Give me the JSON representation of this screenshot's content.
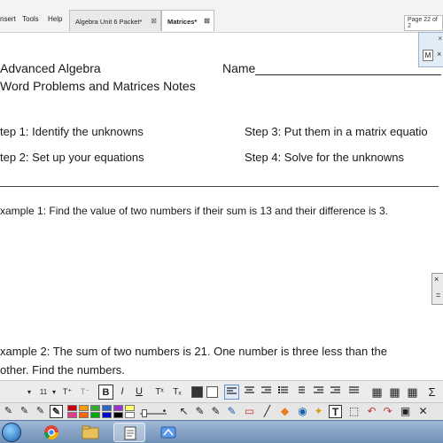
{
  "menu": {
    "insert": "nsert",
    "tools": "Tools",
    "help": "Help"
  },
  "tabs": [
    {
      "label": "Algebra Unit 6 Packet*",
      "close": "⊠"
    },
    {
      "label": "Matrices*",
      "close": "⊠"
    }
  ],
  "page_indicator": "Page 22 of 2",
  "document": {
    "course": "Advanced Algebra",
    "subtitle": "Word Problems and Matrices Notes",
    "name_label": "Name",
    "step1": "tep 1:  Identify the unknowns",
    "step2": "tep 2:  Set up your equations",
    "step3": "Step 3:  Put them in a matrix equatio",
    "step4": "Step 4:  Solve for the unknowns",
    "example1": "xample 1:  Find the value of two numbers if their sum is 13 and their difference is 3.",
    "example2_line1": "xample 2:  The sum of two numbers is 21. One number is three less than the",
    "example2_line2": "other. Find the numbers."
  },
  "mini_panel": {
    "close": "×",
    "button": "M",
    "x": "×"
  },
  "side_panel": {
    "close": "×",
    "sign": "="
  },
  "format_toolbar": {
    "font_size": "11",
    "dropdown": "▾",
    "grow": "T⁺",
    "shrink": "T⁻",
    "bold": "B",
    "italic": "I",
    "underline": "U",
    "superscript": "Tˣ",
    "subscript": "Tₓ",
    "sigma": "Σ",
    "table": "▦"
  },
  "draw_toolbar": {
    "colors": [
      "#cc0000",
      "#ff9900",
      "#33aa33",
      "#3366cc",
      "#9933cc",
      "#ffff66",
      "#e03c8a",
      "#ff6600",
      "#00aa00",
      "#0000cc",
      "#000000",
      "#ffffff"
    ],
    "text_tool": "T",
    "pointer": "↖",
    "pen": "✎",
    "eraser": "▭",
    "undo": "↶",
    "redo": "↷"
  }
}
